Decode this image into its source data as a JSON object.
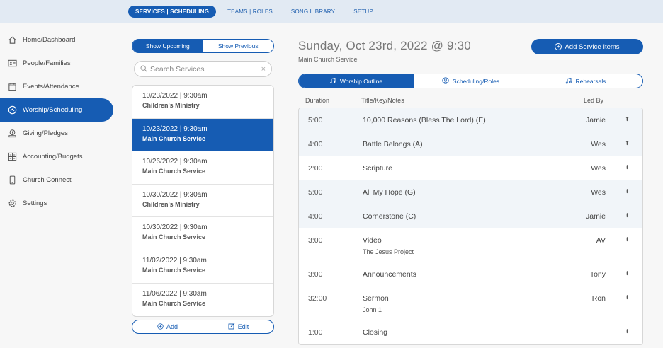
{
  "topnav": [
    {
      "label": "SERVICES | SCHEDULING",
      "active": true
    },
    {
      "label": "TEAMS | ROLES",
      "active": false
    },
    {
      "label": "SONG LIBRARY",
      "active": false
    },
    {
      "label": "SETUP",
      "active": false
    }
  ],
  "sidebar": {
    "items": [
      {
        "label": "Home/Dashboard",
        "icon": "home-icon",
        "active": false
      },
      {
        "label": "People/Families",
        "icon": "contact-card-icon",
        "active": false
      },
      {
        "label": "Events/Attendance",
        "icon": "calendar-icon",
        "active": false
      },
      {
        "label": "Worship/Scheduling",
        "icon": "chevron-up-circle-icon",
        "active": true
      },
      {
        "label": "Giving/Pledges",
        "icon": "donation-icon",
        "active": false
      },
      {
        "label": "Accounting/Budgets",
        "icon": "ledger-icon",
        "active": false
      },
      {
        "label": "Church Connect",
        "icon": "phone-icon",
        "active": false
      },
      {
        "label": "Settings",
        "icon": "gear-icon",
        "active": false
      }
    ]
  },
  "filter": {
    "upcoming": "Show Upcoming",
    "previous": "Show Previous"
  },
  "search": {
    "placeholder": "Search Services"
  },
  "services": [
    {
      "date": "10/23/2022 | 9:30am",
      "name": "Children's Ministry",
      "active": false
    },
    {
      "date": "10/23/2022 | 9:30am",
      "name": "Main Church Service",
      "active": true
    },
    {
      "date": "10/26/2022 | 9:30am",
      "name": "Main Church Service",
      "active": false
    },
    {
      "date": "10/30/2022 | 9:30am",
      "name": "Children's Ministry",
      "active": false
    },
    {
      "date": "10/30/2022 | 9:30am",
      "name": "Main Church Service",
      "active": false
    },
    {
      "date": "11/02/2022 | 9:30am",
      "name": "Main Church Service",
      "active": false
    },
    {
      "date": "11/06/2022 | 9:30am",
      "name": "Main Church Service",
      "active": false
    }
  ],
  "list_actions": {
    "add": "Add",
    "edit": "Edit"
  },
  "main": {
    "title": "Sunday, Oct 23rd, 2022 @ 9:30",
    "subtitle": "Main Church Service",
    "add_button": "Add Service Items",
    "tabs": [
      {
        "label": "Worship Outline",
        "icon": "music-hands-icon",
        "active": true
      },
      {
        "label": "Scheduling/Roles",
        "icon": "user-circle-icon",
        "active": false
      },
      {
        "label": "Rehearsals",
        "icon": "music-note-icon",
        "active": false
      }
    ],
    "columns": {
      "duration": "Duration",
      "title": "Title/Key/Notes",
      "led_by": "Led By"
    },
    "items": [
      {
        "duration": "5:00",
        "title": "10,000 Reasons (Bless The Lord) (E)",
        "note": "",
        "led_by": "Jamie"
      },
      {
        "duration": "4:00",
        "title": "Battle Belongs (A)",
        "note": "",
        "led_by": "Wes"
      },
      {
        "duration": "2:00",
        "title": "Scripture",
        "note": "",
        "led_by": "Wes"
      },
      {
        "duration": "5:00",
        "title": "All My Hope (G)",
        "note": "",
        "led_by": "Wes"
      },
      {
        "duration": "4:00",
        "title": "Cornerstone (C)",
        "note": "",
        "led_by": "Jamie"
      },
      {
        "duration": "3:00",
        "title": "Video",
        "note": "The Jesus Project",
        "led_by": "AV"
      },
      {
        "duration": "3:00",
        "title": "Announcements",
        "note": "",
        "led_by": "Tony"
      },
      {
        "duration": "32:00",
        "title": "Sermon",
        "note": "John 1",
        "led_by": "Ron"
      },
      {
        "duration": "1:00",
        "title": "Closing",
        "note": "",
        "led_by": ""
      }
    ]
  },
  "colors": {
    "accent": "#165cb3",
    "topbar": "#e2eaf3",
    "row_alt": "#f1f5f9"
  }
}
